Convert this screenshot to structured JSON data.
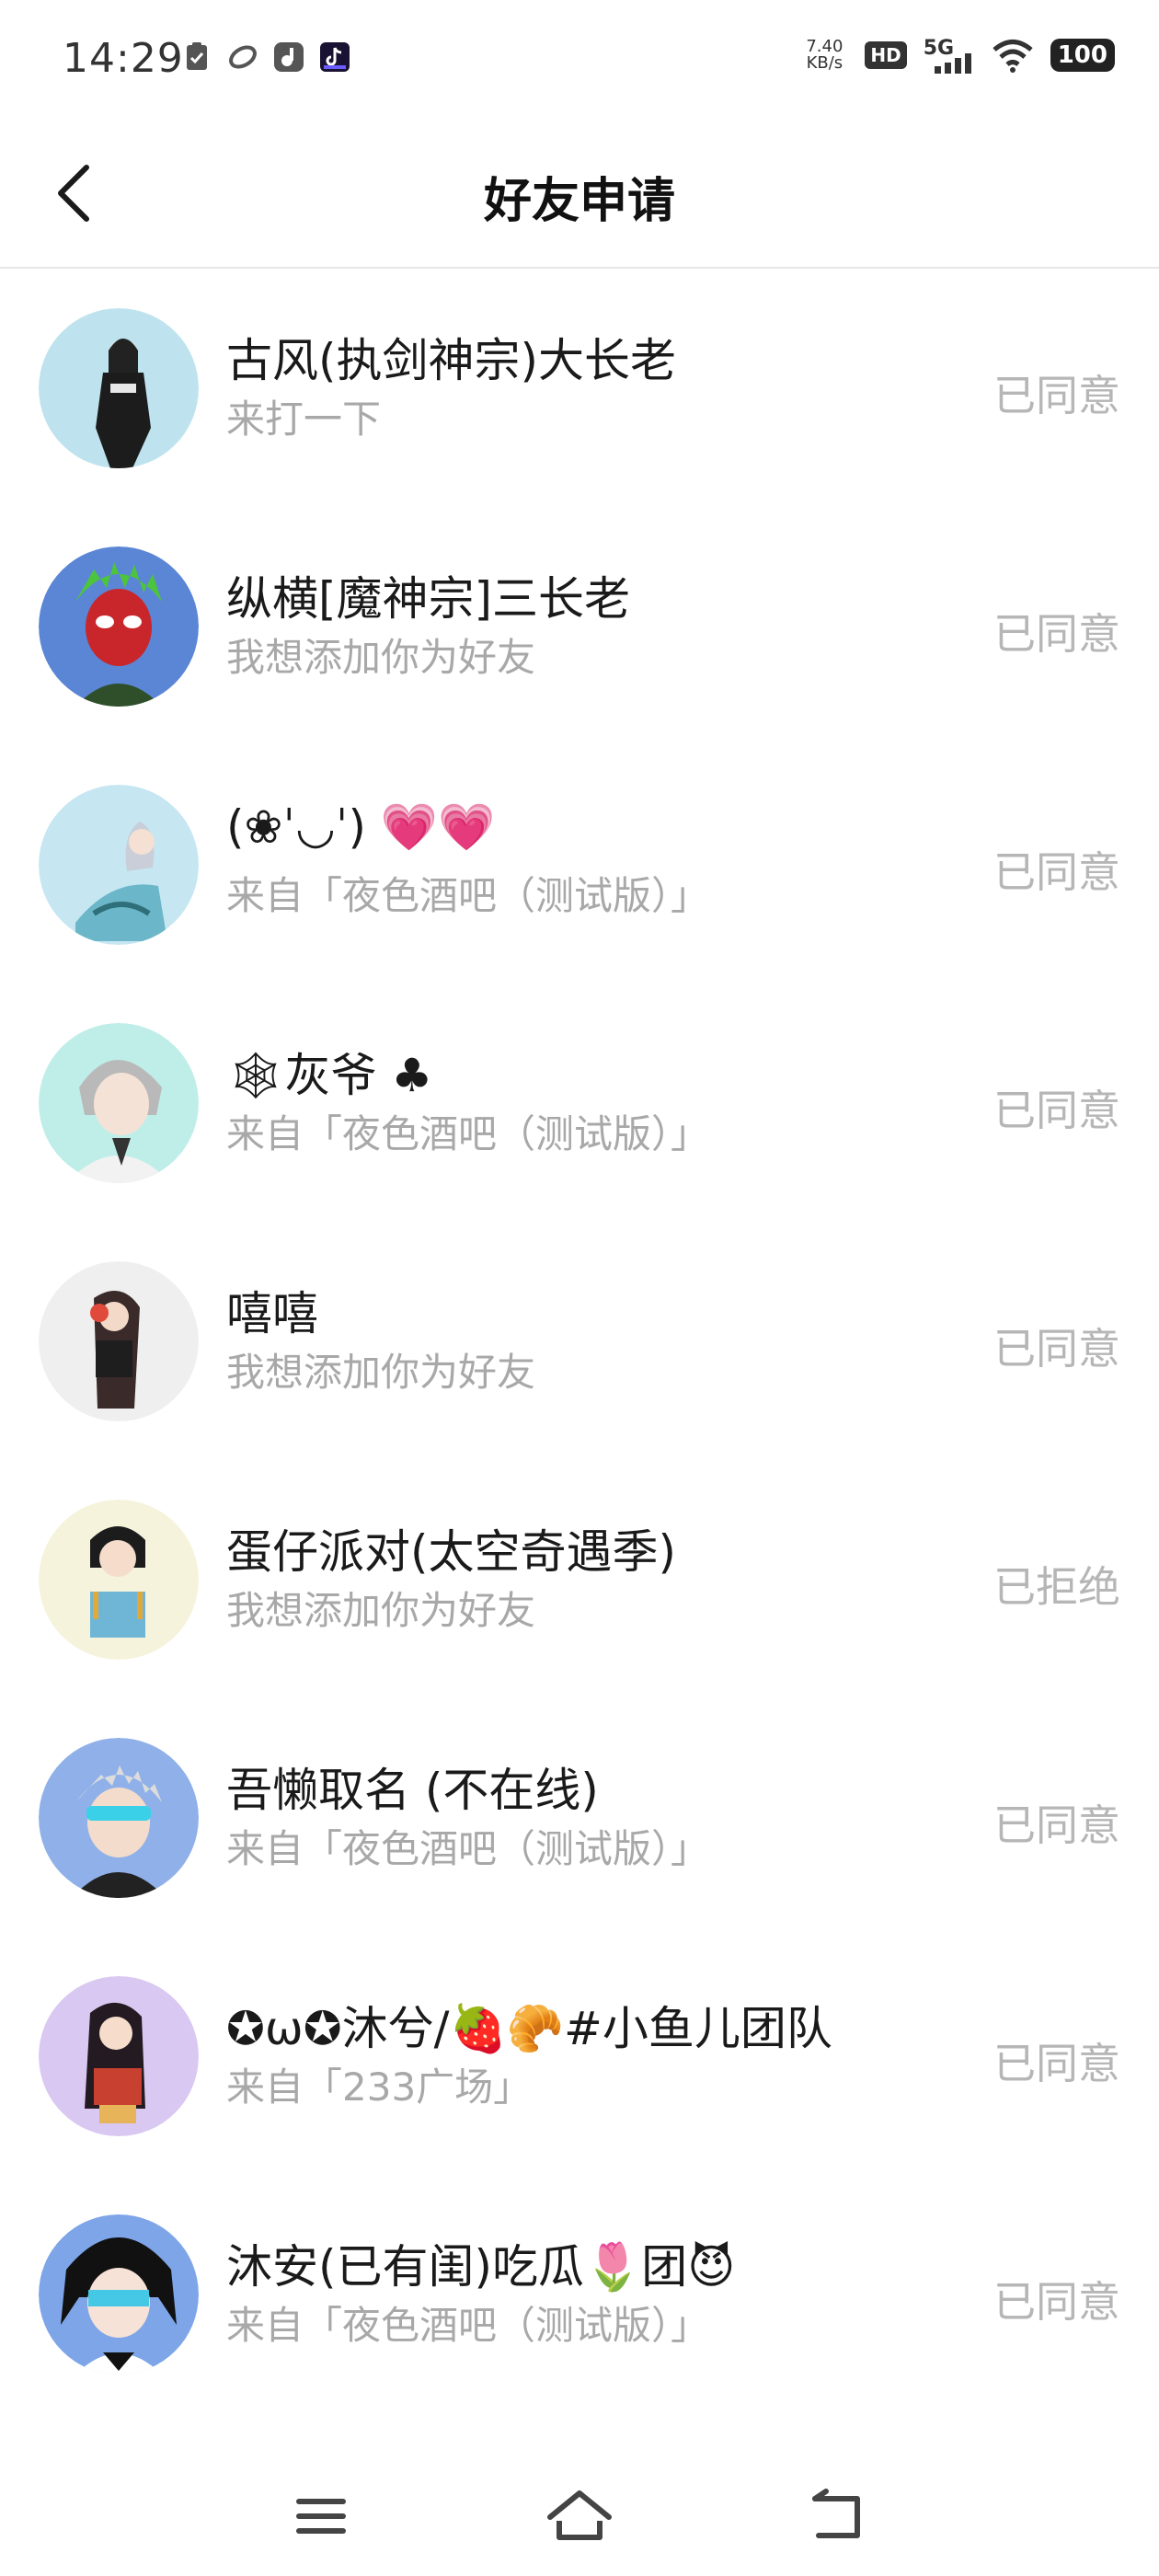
{
  "status_bar": {
    "time": "14:29",
    "net_speed_value": "7.40",
    "net_speed_unit": "KB/s",
    "hd": "HD",
    "network": "5G",
    "battery": "100"
  },
  "header": {
    "title": "好友申请"
  },
  "requests": [
    {
      "name": "古风(执剑神宗)大长老",
      "message": "来打一下",
      "status": "已同意",
      "avatar_bg": "#bfe3ee"
    },
    {
      "name": "纵横[魔神宗]三长老",
      "message": "我想添加你为好友",
      "status": "已同意",
      "avatar_bg": "#5b86d6"
    },
    {
      "name": "(❀ˈ◡ˈ) 💗💗",
      "message": "来自「夜色酒吧（测试版）」",
      "status": "已同意",
      "avatar_bg": "#c6e6f2"
    },
    {
      "name": "🕸灰爷 ♣",
      "message": "来自「夜色酒吧（测试版）」",
      "status": "已同意",
      "avatar_bg": "#bfeee9"
    },
    {
      "name": "嘻嘻",
      "message": "我想添加你为好友",
      "status": "已同意",
      "avatar_bg": "#efefef"
    },
    {
      "name": "蛋仔派对(太空奇遇季)",
      "message": "我想添加你为好友",
      "status": "已拒绝",
      "avatar_bg": "#f6f3dc"
    },
    {
      "name": "吾懒取名 (不在线)",
      "message": "来自「夜色酒吧（测试版）」",
      "status": "已同意",
      "avatar_bg": "#8fb0e8"
    },
    {
      "name": "✪ω✪沐兮/🍓🥐#小鱼儿团队",
      "message": "来自「233广场」",
      "status": "已同意",
      "avatar_bg": "#d9c8f2"
    },
    {
      "name": "沐安(已有闺)吃瓜🌷团😈",
      "message": "来自「夜色酒吧（测试版）」",
      "status": "已同意",
      "avatar_bg": "#7da5e8"
    }
  ],
  "nav": {
    "menu_icon": "menu-icon",
    "home_icon": "home-icon",
    "back_icon": "back-icon"
  }
}
